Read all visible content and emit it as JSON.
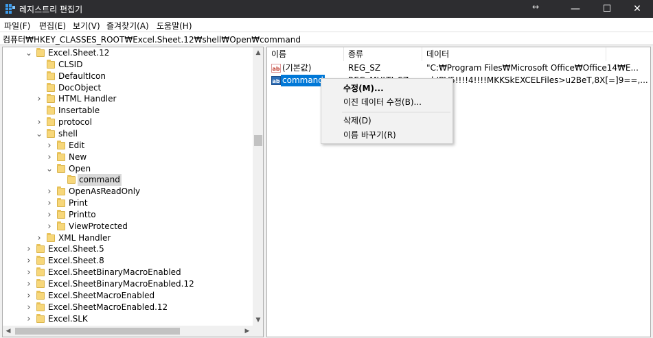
{
  "window": {
    "title": "레지스트리 편집기",
    "resize_glyph": "↔",
    "minimize_glyph": "—",
    "maximize_glyph": "☐",
    "close_glyph": "✕"
  },
  "menu": [
    "파일(F)",
    "편집(E)",
    "보기(V)",
    "즐겨찾기(A)",
    "도움말(H)"
  ],
  "address": "컴퓨터₩HKEY_CLASSES_ROOT₩Excel.Sheet.12₩shell₩Open₩command",
  "tree": [
    {
      "label": "Excel.Sheet.12",
      "chev": "v"
    },
    {
      "label": "CLSID",
      "chev": ""
    },
    {
      "label": "DefaultIcon",
      "chev": ""
    },
    {
      "label": "DocObject",
      "chev": ""
    },
    {
      "label": "HTML Handler",
      "chev": ">"
    },
    {
      "label": "Insertable",
      "chev": ""
    },
    {
      "label": "protocol",
      "chev": ">"
    },
    {
      "label": "shell",
      "chev": "v"
    },
    {
      "label": "Edit",
      "chev": ">"
    },
    {
      "label": "New",
      "chev": ">"
    },
    {
      "label": "Open",
      "chev": "v"
    },
    {
      "label": "command",
      "chev": "",
      "selected": true
    },
    {
      "label": "OpenAsReadOnly",
      "chev": ">"
    },
    {
      "label": "Print",
      "chev": ">"
    },
    {
      "label": "Printto",
      "chev": ">"
    },
    {
      "label": "ViewProtected",
      "chev": ">"
    },
    {
      "label": "XML Handler",
      "chev": ">"
    },
    {
      "label": "Excel.Sheet.5",
      "chev": ">"
    },
    {
      "label": "Excel.Sheet.8",
      "chev": ">"
    },
    {
      "label": "Excel.SheetBinaryMacroEnabled",
      "chev": ">"
    },
    {
      "label": "Excel.SheetBinaryMacroEnabled.12",
      "chev": ">"
    },
    {
      "label": "Excel.SheetMacroEnabled",
      "chev": ">"
    },
    {
      "label": "Excel.SheetMacroEnabled.12",
      "chev": ">"
    },
    {
      "label": "Excel.SLK",
      "chev": ">"
    }
  ],
  "scroll": {
    "up": "▲",
    "down": "▼",
    "left": "◀",
    "right": "▶"
  },
  "list": {
    "headers": {
      "name": "이름",
      "type": "종류",
      "data": "데이터"
    },
    "rows": [
      {
        "icon": "ab",
        "name": "(기본값)",
        "type": "REG_SZ",
        "data": "\"C:₩Program Files₩Microsoft Office₩Office14₩E..."
      },
      {
        "icon": "ab",
        "name": "command",
        "type": "REG_MULTI_SZ",
        "data": "xb'BV5!!!!4!!!!MKKSkEXCELFiles>u2BeT,8X[=]9==,..."
      }
    ]
  },
  "context_menu": {
    "modify": "수정(M)...",
    "modify_binary": "이진 데이터 수정(B)...",
    "delete": "삭제(D)",
    "rename": "이름 바꾸기(R)"
  },
  "colors": {
    "titlebar": "#2d2d30",
    "selection": "#0078d7",
    "folder": "#f7d77a"
  }
}
